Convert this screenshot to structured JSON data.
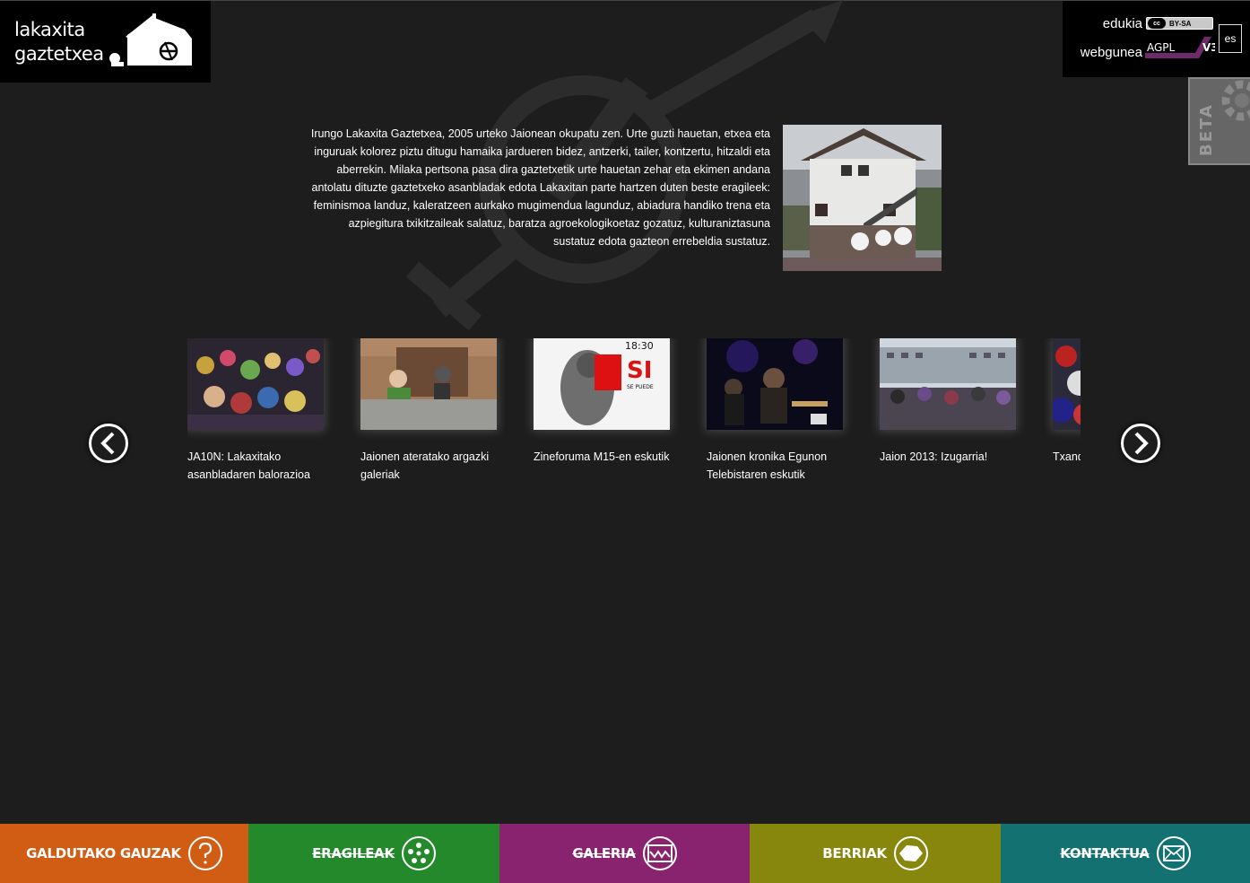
{
  "logo": {
    "line1": "lakaxita",
    "line2": "gaztetxea"
  },
  "license": {
    "content_label": "edukia",
    "content_badge": "BY-SA",
    "cc_mark": "cc",
    "web_label": "webgunea",
    "web_badge": "AGPL",
    "web_badge_version": "V3",
    "language": "es"
  },
  "beta": {
    "label": "BETA"
  },
  "intro": {
    "text": "Irungo Lakaxita Gaztetxea, 2005 urteko Jaionean okupatu zen. Urte guzti hauetan, etxea eta inguruak kolorez piztu ditugu hamaika jardueren bidez, antzerki, tailer, kontzertu, hitzaldi eta aberrekin. Milaka pertsona pasa dira gaztetxetik urte hauetan zehar eta ekimen andana antolatu dituzte gaztetxeko asanbladak edota Lakaxitan parte hartzen duten beste eragileek: feminismoa landuz, kaleratzeen aurkako mugimendua lagunduz, abiadura handiko trena eta azpiegitura txikitzaileak salatuz, baratza agroekologikoetaz gozatuz, kulturaniztasuna sustatuz edota gazteon errebeldia sustatuz."
  },
  "carousel": {
    "items": [
      {
        "caption": "JA10N: Lakaxitako asanbladaren balorazioa",
        "thumb": "crowd-photo"
      },
      {
        "caption": "Jaionen ateratako argazki galeriak",
        "thumb": "balcony-photo"
      },
      {
        "caption": "Zineforuma M15-en eskutik",
        "thumb": "poster-photo"
      },
      {
        "caption": "Jaionen kronika Egunon Telebistaren eskutik",
        "thumb": "concert-photo"
      },
      {
        "caption": "Jaion 2013: Izugarria!",
        "thumb": "street-photo"
      },
      {
        "caption": "Txandak dira, eta da Jaio",
        "thumb": "colorful-photo"
      }
    ],
    "poster_text_top": "18:30",
    "poster_text_main": "SI",
    "poster_text_sub": "SE PUEDE"
  },
  "footer": {
    "items": [
      {
        "label": "GALDUTAKO GAUZAK",
        "color": "#d15c13",
        "icon": "question-icon"
      },
      {
        "label": "ERAGILEAK",
        "color": "#23892a",
        "icon": "dots-icon"
      },
      {
        "label": "GALERIA",
        "color": "#8a236f",
        "icon": "gallery-icon"
      },
      {
        "label": "BERRIAK",
        "color": "#87860d",
        "icon": "news-icon"
      },
      {
        "label": "KONTAKTUA",
        "color": "#147171",
        "icon": "mail-icon"
      }
    ]
  }
}
